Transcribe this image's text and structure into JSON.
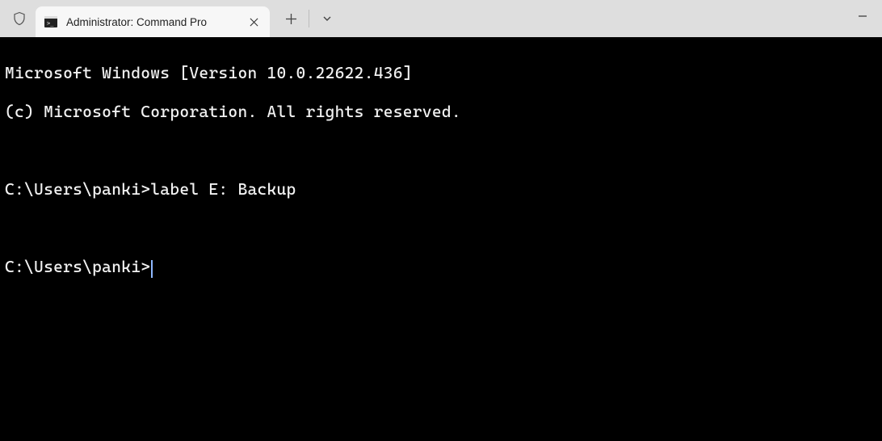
{
  "tab": {
    "title": "Administrator: Command Pro"
  },
  "terminal": {
    "line1": "Microsoft Windows [Version 10.0.22622.436]",
    "line2": "(c) Microsoft Corporation. All rights reserved.",
    "blank1": "",
    "line3_prompt": "C:\\Users\\panki>",
    "line3_cmd": "label E: Backup",
    "blank2": "",
    "line4_prompt": "C:\\Users\\panki>"
  }
}
